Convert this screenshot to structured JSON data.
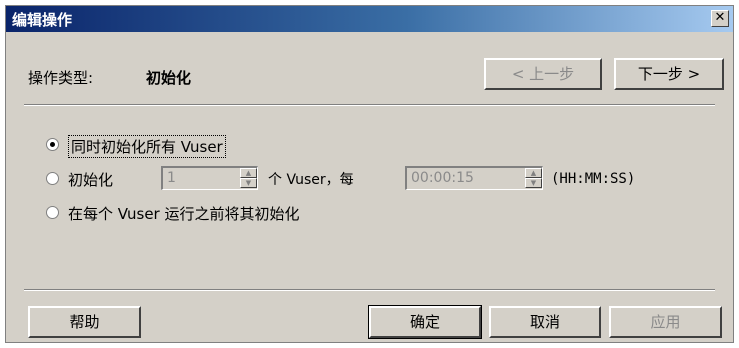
{
  "window": {
    "title": "编辑操作",
    "close_glyph": "✕"
  },
  "header": {
    "operation_type_label": "操作类型:",
    "operation_type_value": "初始化",
    "prev_button": "< 上一步",
    "next_button": "下一步 >"
  },
  "options": {
    "option1_label": "同时初始化所有 Vuser",
    "option2_prefix": "初始化",
    "vuser_count": "1",
    "option2_middle": "个 Vuser，每",
    "interval": "00:00:15",
    "interval_format": "(HH:MM:SS)",
    "option3_label": "在每个 Vuser 运行之前将其初始化",
    "selected": "option1"
  },
  "footer": {
    "help_button": "帮助",
    "ok_button": "确定",
    "cancel_button": "取消",
    "apply_button": "应用"
  }
}
